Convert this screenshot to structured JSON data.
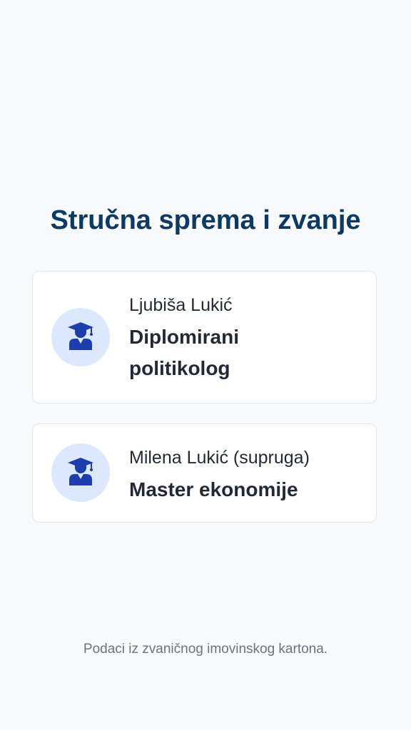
{
  "page": {
    "title": "Stručna sprema i zvanje"
  },
  "cards": [
    {
      "icon": "graduate-icon",
      "name": "Ljubiša Lukić",
      "degree": "Diplomirani politikolog"
    },
    {
      "icon": "graduate-icon",
      "name": "Milena Lukić (supruga)",
      "degree": "Master ekonomije"
    }
  ],
  "footer": {
    "note": "Podaci iz zvaničnog imovinskog kartona."
  },
  "colors": {
    "title": "#0c3a66",
    "icon": "#1d3fae",
    "avatar_bg": "#dbe8fd",
    "text": "#1f2937",
    "muted": "#6b7280",
    "background": "#f8f9fb"
  }
}
